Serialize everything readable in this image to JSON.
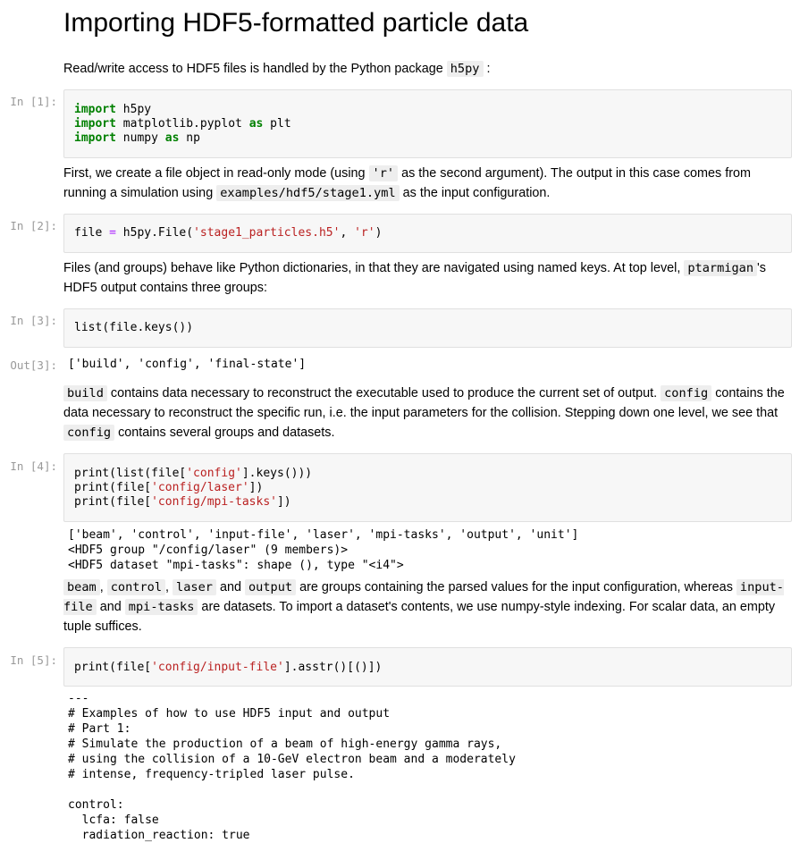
{
  "title": "Importing HDF5-formatted particle data",
  "intro": {
    "text_before": "Read/write access to HDF5 files is handled by the Python package ",
    "code": "h5py",
    "text_after": ":"
  },
  "cells": {
    "c1": {
      "prompt": "In [1]:",
      "lines": [
        {
          "kw": "import",
          "rest": " h5py"
        },
        {
          "kw": "import",
          "rest": " matplotlib.pyplot ",
          "kw2": "as",
          "rest2": " plt"
        },
        {
          "kw": "import",
          "rest": " numpy ",
          "kw2": "as",
          "rest2": " np"
        }
      ]
    },
    "c2": {
      "prompt": "In [2]:",
      "a": "file ",
      "eq": "=",
      "b": " h5py.File(",
      "s1": "'stage1_particles.h5'",
      "c": ", ",
      "s2": "'r'",
      "d": ")"
    },
    "c3": {
      "prompt": "In [3]:",
      "a": "list",
      "b": "(file.keys())"
    },
    "o3": {
      "prompt": "Out[3]:",
      "text": "['build', 'config', 'final-state']"
    },
    "c4": {
      "prompt": "In [4]:",
      "l1a": "print(list(file[",
      "l1s": "'config'",
      "l1b": "].keys()))",
      "l2a": "print(file[",
      "l2s": "'config/laser'",
      "l2b": "])",
      "l3a": "print(file[",
      "l3s": "'config/mpi-tasks'",
      "l3b": "])"
    },
    "o4": {
      "lines": [
        "['beam', 'control', 'input-file', 'laser', 'mpi-tasks', 'output', 'unit']",
        "<HDF5 group \"/config/laser\" (9 members)>",
        "<HDF5 dataset \"mpi-tasks\": shape (), type \"<i4\">"
      ]
    },
    "c5": {
      "prompt": "In [5]:",
      "a": "print(file[",
      "s": "'config/input-file'",
      "b": "].asstr()[()])"
    },
    "o5": {
      "lines": [
        "---",
        "# Examples of how to use HDF5 input and output",
        "# Part 1:",
        "# Simulate the production of a beam of high-energy gamma rays,",
        "# using the collision of a 10-GeV electron beam and a moderately",
        "# intense, frequency-tripled laser pulse.",
        "",
        "control:",
        "  lcfa: false",
        "  radiation_reaction: true"
      ]
    }
  },
  "para1": {
    "t1": "First, we create a file object in read-only mode (using ",
    "c1": "'r'",
    "t2": " as the second argument). The output in this case comes from running a simulation using ",
    "c2": "examples/hdf5/stage1.yml",
    "t3": " as the input configuration."
  },
  "para2": {
    "t1": "Files (and groups) behave like Python dictionaries, in that they are navigated using named keys. At top level, ",
    "c1": "ptarmigan",
    "t2": "'s HDF5 output contains three groups:"
  },
  "para3": {
    "c1": "build",
    "t1": " contains data necessary to reconstruct the executable used to produce the current set of output. ",
    "c2": "config",
    "t2": " contains the data necessary to reconstruct the specific run, i.e. the input parameters for the collision. Stepping down one level, we see that ",
    "c3": "config",
    "t3": " contains several groups and datasets."
  },
  "para4": {
    "c1": "beam",
    "t1": ", ",
    "c2": "control",
    "t2": ", ",
    "c3": "laser",
    "t3": " and ",
    "c4": "output",
    "t4": " are groups containing the parsed values for the input configuration, whereas ",
    "c5": "input-file",
    "t5": " and ",
    "c6": "mpi-tasks",
    "t6": " are datasets. To import a dataset's contents, we use numpy-style indexing. For scalar data, an empty tuple suffices."
  }
}
